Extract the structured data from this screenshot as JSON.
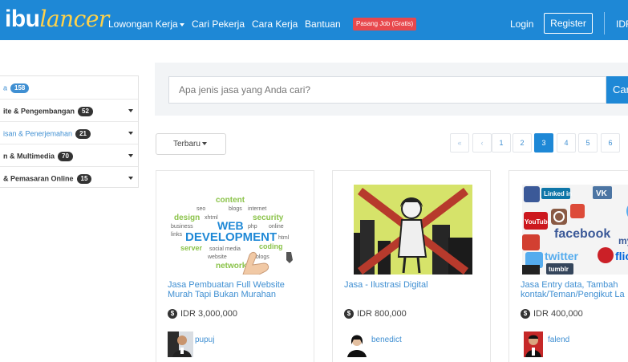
{
  "header": {
    "brand_prefix": "ibu",
    "brand_suffix": "lancer",
    "nav": [
      "Lowongan Kerja",
      "Cari Pekerja",
      "Cara Kerja",
      "Bantuan"
    ],
    "post_job_label": "Pasang Job (Gratis)",
    "login_label": "Login",
    "register_label": "Register",
    "currency_label": "IDR"
  },
  "sidebar": {
    "categories": [
      {
        "label": "a",
        "count": "158"
      },
      {
        "label": "ite & Pengembangan",
        "count": "52"
      },
      {
        "label": "isan & Penerjemahan",
        "count": "21"
      },
      {
        "label": "n & Multimedia",
        "count": "70"
      },
      {
        "label": "& Pemasaran Online",
        "count": "15"
      }
    ]
  },
  "search": {
    "placeholder": "Apa jenis jasa yang Anda cari?",
    "button_label": "Cari"
  },
  "sort_label": "Terbaru",
  "pagination": {
    "first": "«",
    "prev": "‹",
    "pages": [
      "1",
      "2",
      "3",
      "4",
      "5",
      "6"
    ],
    "active_page": "3"
  },
  "services": [
    {
      "title": "Jasa Pembuatan Full Website Murah Tapi Bukan Murahan",
      "price": "IDR 3,000,000",
      "seller": "pupuj"
    },
    {
      "title": "Jasa - Ilustrasi Digital",
      "price": "IDR 800,000",
      "seller": "benedict"
    },
    {
      "title": "Jasa Entry data, Tambah kontak/Teman/Pengikut La",
      "price": "IDR 400,000",
      "seller": "falend"
    }
  ],
  "thumb_text": {
    "web_dev": [
      "content",
      "seo",
      "blogs",
      "internet",
      "design",
      "xhtml",
      "security",
      "business",
      "WEB",
      "php",
      "online",
      "links",
      "DEVELOPMENT",
      "html",
      "server",
      "social media",
      "coding",
      "website",
      "blogs",
      "network"
    ],
    "social": [
      "Linked in",
      "YouTube",
      "facebook",
      "twitter",
      "flickr",
      "tumblr",
      "VK",
      "my"
    ]
  },
  "colors": {
    "navbar": "#1e88d6",
    "brand_accent": "#ffd24a",
    "post_job": "#e8484d",
    "link": "#3f8fd2"
  }
}
